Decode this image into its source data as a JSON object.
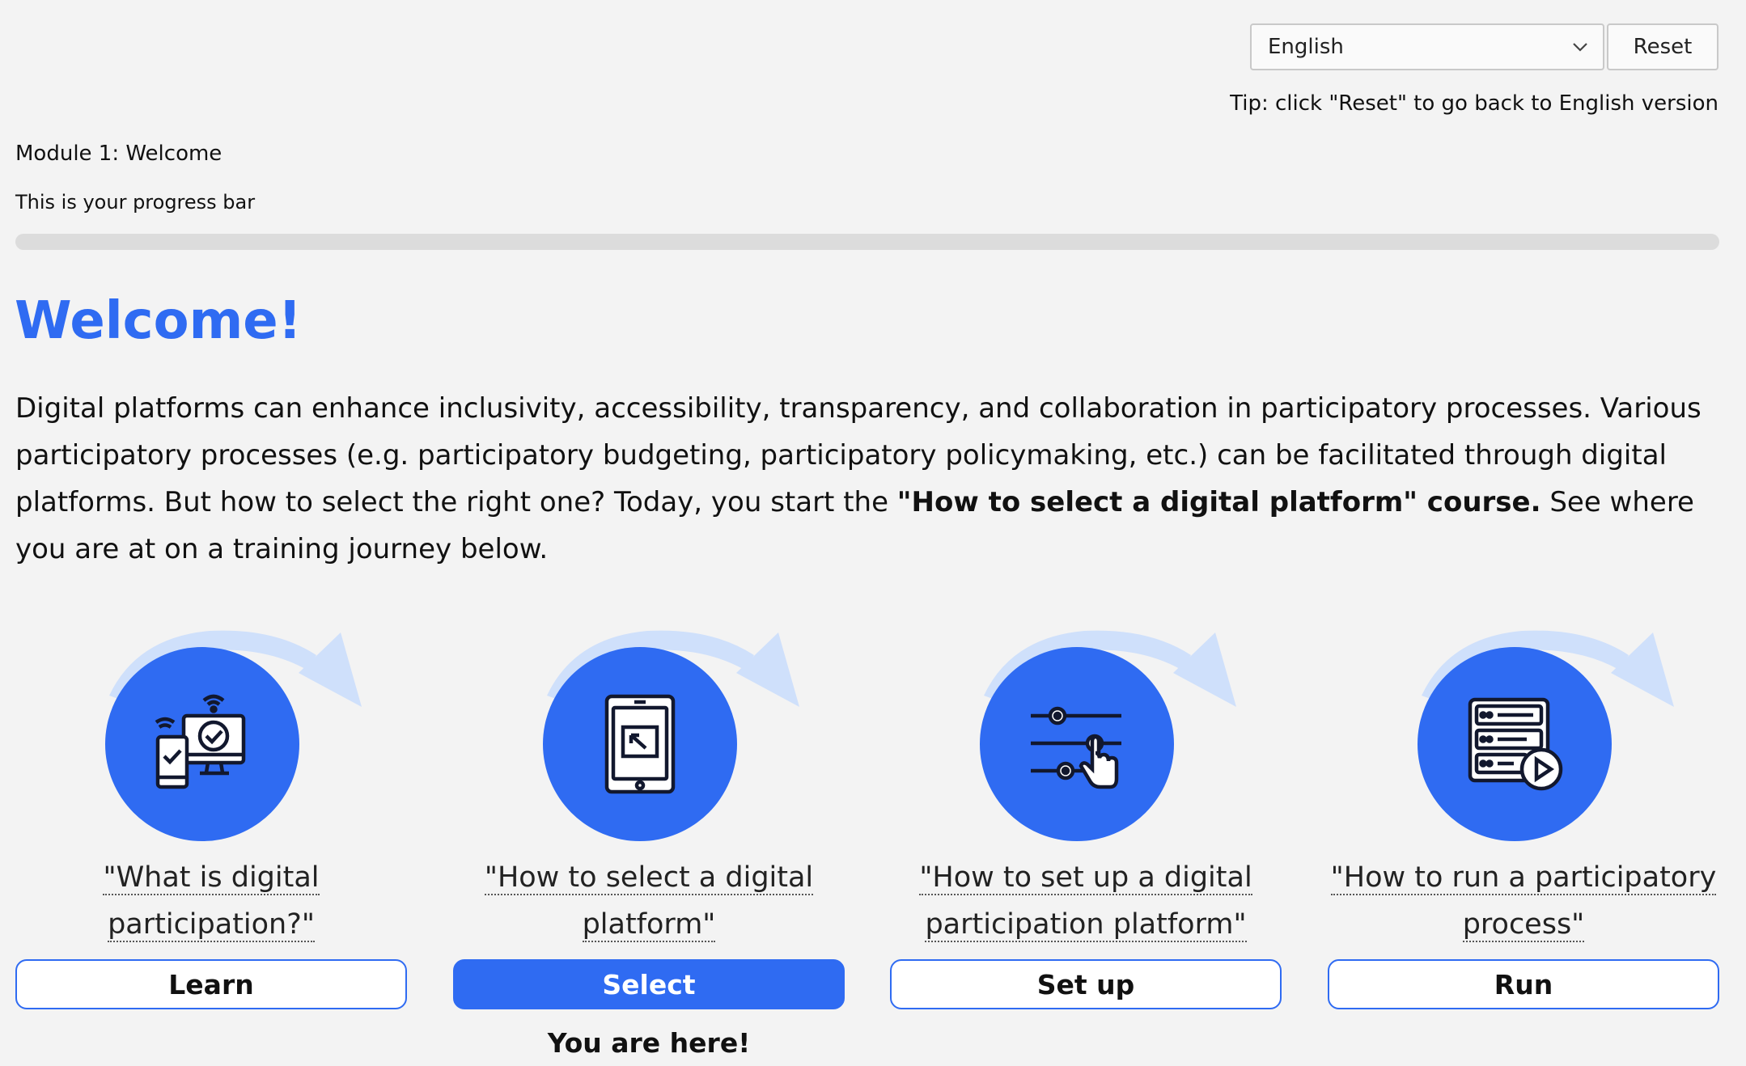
{
  "language": {
    "selected": "English",
    "reset_label": "Reset",
    "tip": "Tip: click \"Reset\" to go back to English version"
  },
  "module": {
    "title": "Module 1: Welcome",
    "progress_label": "This is your progress bar",
    "progress_percent": 0
  },
  "content": {
    "heading": "Welcome!",
    "intro_part1": "Digital platforms can enhance inclusivity, accessibility, transparency, and collaboration in participatory processes. Various participatory processes (e.g. participatory budgeting, participatory policymaking, etc.) can be facilitated through digital platforms. But how to select the right one? Today, you start the ",
    "intro_bold": "\"How to select a digital platform\" course.",
    "intro_part2": " See where you are at on a training journey below."
  },
  "journey": {
    "steps": [
      {
        "caption": "\"What is digital participation?\"",
        "button": "Learn",
        "icon": "devices-check-icon"
      },
      {
        "caption": "\"How to select a digital platform\"",
        "button": "Select",
        "icon": "tablet-select-icon"
      },
      {
        "caption": "\"How to set up a digital participation platform\"",
        "button": "Set up",
        "icon": "settings-sliders-icon"
      },
      {
        "caption": "\"How to run a participatory process\"",
        "button": "Run",
        "icon": "server-play-icon"
      }
    ],
    "you_are_here": "You are here!"
  },
  "colors": {
    "accent": "#2f6bf2",
    "arrow": "#cfe0fb",
    "background": "#f3f3f3"
  }
}
